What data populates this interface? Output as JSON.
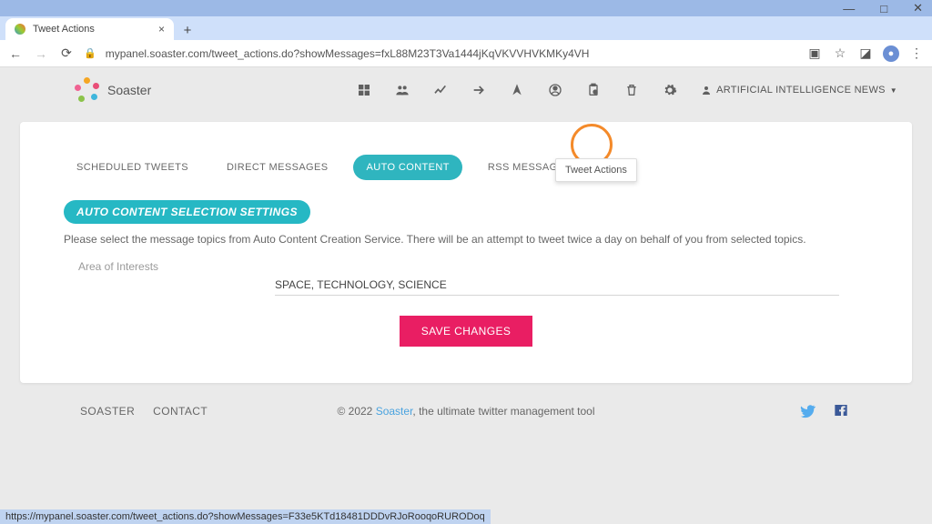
{
  "browser": {
    "tab_title": "Tweet Actions",
    "url": "mypanel.soaster.com/tweet_actions.do?showMessages=fxL88M23T3Va1444jKqVKVVHVKMKy4VH",
    "status_url": "https://mypanel.soaster.com/tweet_actions.do?showMessages=F33e5KTd18481DDDvRJoRooqoRURODoq"
  },
  "app": {
    "name": "Soaster",
    "tooltip": "Tweet Actions",
    "news_dropdown": "ARTIFICIAL INTELLIGENCE NEWS"
  },
  "tabs": {
    "scheduled": "SCHEDULED TWEETS",
    "direct": "DIRECT MESSAGES",
    "auto": "AUTO CONTENT",
    "rss": "RSS MESSAGES"
  },
  "panel": {
    "title": "AUTO CONTENT SELECTION SETTINGS",
    "description": "Please select the message topics from Auto Content Creation Service. There will be an attempt to tweet twice a day on behalf of you from selected topics.",
    "field_label": "Area of Interests",
    "field_value": "SPACE, TECHNOLOGY, SCIENCE",
    "save": "SAVE CHANGES"
  },
  "footer": {
    "link1": "SOASTER",
    "link2": "CONTACT",
    "copyright_prefix": "© 2022 ",
    "brand": "Soaster",
    "copyright_suffix": ", the ultimate twitter management tool"
  }
}
